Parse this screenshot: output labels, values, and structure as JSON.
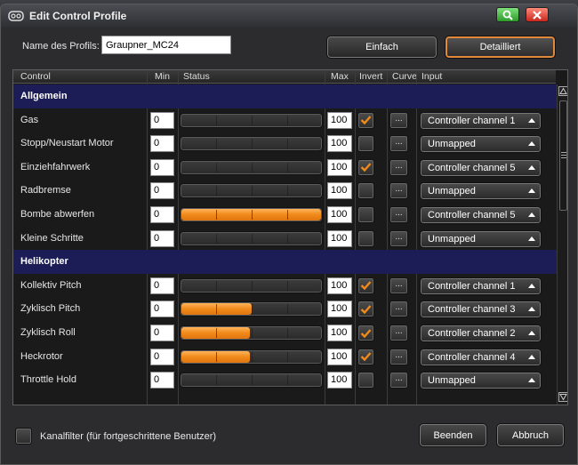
{
  "window": {
    "title": "Edit Control Profile",
    "bg_title": "",
    "min_color": "#3fae3a",
    "close_color": "#d8342a"
  },
  "profile": {
    "name_label": "Name des Profils:",
    "name_value": "Graupner_MC24"
  },
  "modes": {
    "simple_label": "Einfach",
    "detailed_label": "Detailliert",
    "active": "detailed"
  },
  "table": {
    "headers": {
      "control": "Control",
      "min": "Min",
      "status": "Status",
      "max": "Max",
      "invert": "Invert",
      "curve": "Curve",
      "input": "Input"
    },
    "sections": [
      {
        "name": "Allgemein",
        "rows": [
          {
            "control": "Gas",
            "min": "0",
            "status": 0.0,
            "max": "100",
            "invert": true,
            "curve": "...",
            "input": "Controller channel 1"
          },
          {
            "control": "Stopp/Neustart Motor",
            "min": "0",
            "status": 0.0,
            "max": "100",
            "invert": false,
            "curve": "...",
            "input": "Unmapped"
          },
          {
            "control": "Einziehfahrwerk",
            "min": "0",
            "status": 0.0,
            "max": "100",
            "invert": true,
            "curve": "...",
            "input": "Controller channel 5"
          },
          {
            "control": "Radbremse",
            "min": "0",
            "status": 0.0,
            "max": "100",
            "invert": false,
            "curve": "...",
            "input": "Unmapped"
          },
          {
            "control": "Bombe abwerfen",
            "min": "0",
            "status": 1.0,
            "max": "100",
            "invert": false,
            "curve": "...",
            "input": "Controller channel 5"
          },
          {
            "control": "Kleine Schritte",
            "min": "0",
            "status": 0.0,
            "max": "100",
            "invert": false,
            "curve": "...",
            "input": "Unmapped"
          }
        ]
      },
      {
        "name": "Helikopter",
        "rows": [
          {
            "control": "Kollektiv Pitch",
            "min": "0",
            "status": 0.0,
            "max": "100",
            "invert": true,
            "curve": "...",
            "input": "Controller channel 1"
          },
          {
            "control": "Zyklisch Pitch",
            "min": "0",
            "status": 0.5,
            "max": "100",
            "invert": true,
            "curve": "...",
            "input": "Controller channel 3"
          },
          {
            "control": "Zyklisch Roll",
            "min": "0",
            "status": 0.49,
            "max": "100",
            "invert": true,
            "curve": "...",
            "input": "Controller channel 2"
          },
          {
            "control": "Heckrotor",
            "min": "0",
            "status": 0.49,
            "max": "100",
            "invert": true,
            "curve": "...",
            "input": "Controller channel 4"
          },
          {
            "control": "Throttle Hold",
            "min": "0",
            "status": 0.0,
            "max": "100",
            "invert": false,
            "curve": "...",
            "input": "Unmapped"
          }
        ]
      }
    ]
  },
  "footer": {
    "filter_label": "Kanalfilter (für fortgeschrittene Benutzer)",
    "ok_label": "Beenden",
    "cancel_label": "Abbruch"
  },
  "colors": {
    "section_bg": "#1c1c56",
    "accent": "#f08a1a",
    "active_outline": "#e2883a"
  }
}
